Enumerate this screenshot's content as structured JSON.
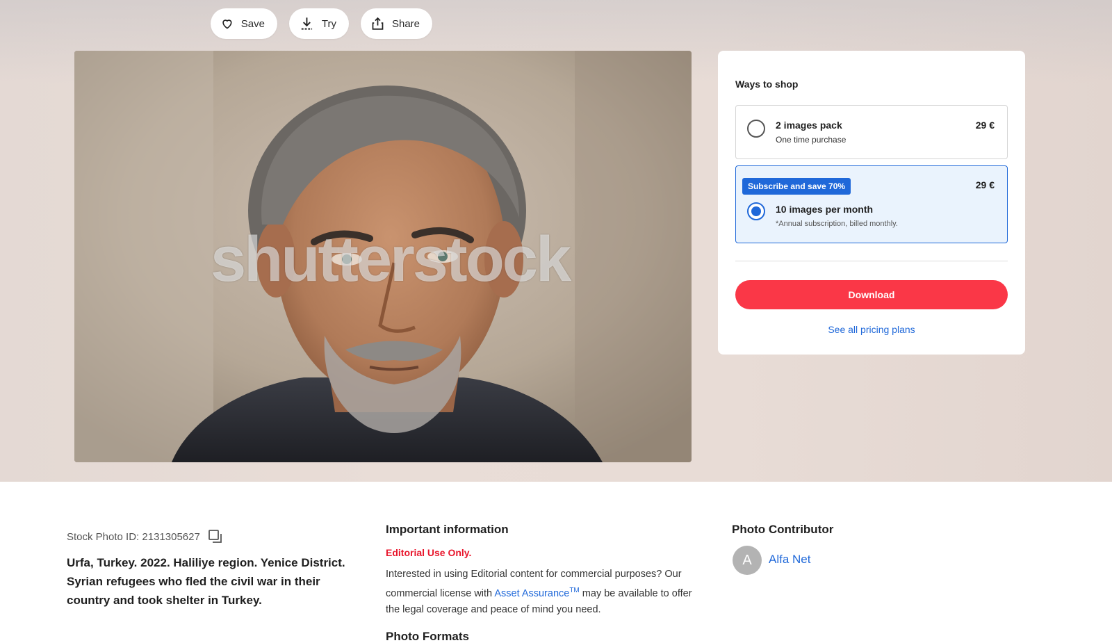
{
  "actions": {
    "save": "Save",
    "try": "Try",
    "share": "Share"
  },
  "photo": {
    "watermark": "shutterstock"
  },
  "shop": {
    "title": "Ways to shop",
    "options": [
      {
        "name": "2 images pack",
        "desc": "One time purchase",
        "price": "29 €",
        "selected": false
      },
      {
        "badge": "Subscribe and save 70%",
        "name": "10 images per month",
        "desc": "*Annual subscription, billed monthly.",
        "price": "29 €",
        "selected": true
      }
    ],
    "download": "Download",
    "pricing_link": "See all pricing plans"
  },
  "details": {
    "stock_id": "Stock Photo ID: 2131305627",
    "caption": "Urfa, Turkey. 2022. Haliliye region. Yenice District. Syrian refugees who fled the civil war in their country and took shelter in Turkey.",
    "info_heading": "Important information",
    "editorial": "Editorial Use Only.",
    "info_text_1": "Interested in using Editorial content for commercial purposes? Our commercial license with ",
    "info_link": "Asset Assurance",
    "info_tm": "TM",
    "info_text_2": " may be available to offer the legal coverage and peace of mind you need.",
    "formats_heading": "Photo Formats",
    "contributor_heading": "Photo Contributor",
    "contributor_initial": "A",
    "contributor_name": "Alfa Net"
  },
  "colors": {
    "accent_blue": "#1f68d9",
    "download_red": "#fa3747",
    "editorial_red": "#e8152b"
  }
}
